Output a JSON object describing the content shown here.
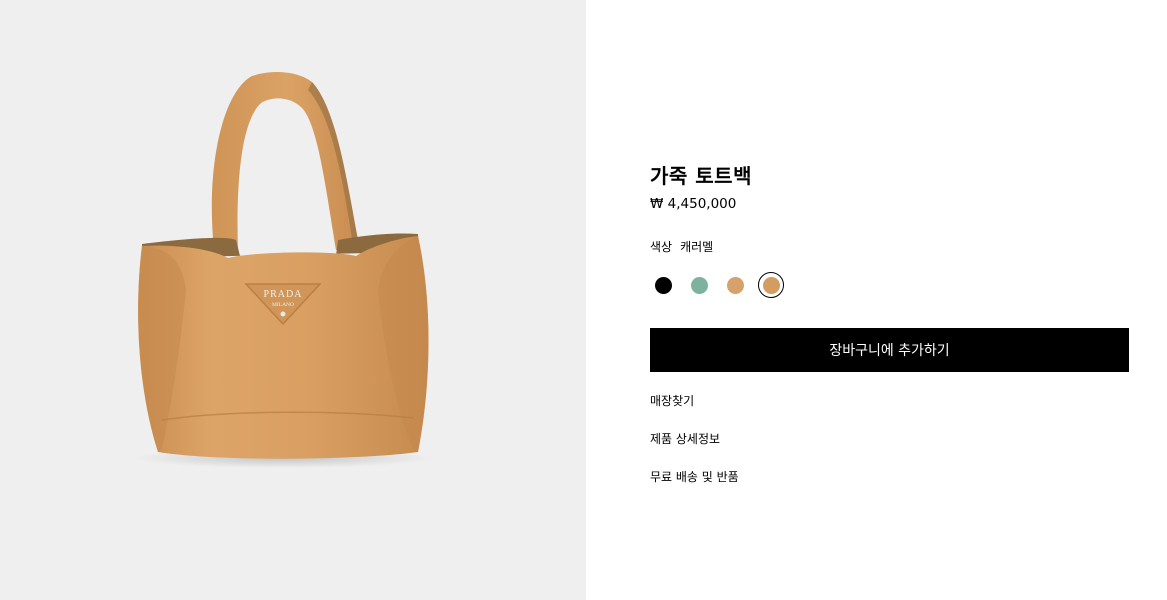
{
  "product": {
    "title": "가죽 토트백",
    "price": "₩ 4,450,000",
    "color_label": "색상",
    "color_value": "캐러멜"
  },
  "swatches": [
    {
      "name": "black",
      "color": "#000000",
      "selected": false
    },
    {
      "name": "mint",
      "color": "#7db39e",
      "selected": false
    },
    {
      "name": "caramel-light",
      "color": "#d6a16a",
      "selected": false
    },
    {
      "name": "caramel",
      "color": "#d49d60",
      "selected": true
    }
  ],
  "actions": {
    "add_to_cart": "장바구니에 추가하기"
  },
  "links": {
    "store_finder": "매장찾기",
    "product_details": "제품 상세정보",
    "shipping_returns": "무료 배송 및 반품"
  },
  "image": {
    "logo_text_top": "PRADA",
    "logo_text_bottom": "MILANO",
    "bag_color": "#d89f63",
    "background": "#efefef"
  }
}
